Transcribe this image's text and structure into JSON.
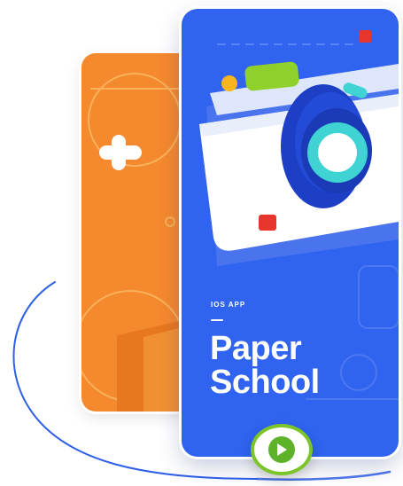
{
  "app": {
    "eyebrow": "IOS APP",
    "title_line1": "Paper",
    "title_line2": "School"
  },
  "colors": {
    "primary_blue": "#2f63f0",
    "orange": "#f5892e",
    "accent_green": "#7bc52a",
    "accent_red": "#e8352c",
    "accent_yellow": "#f7b51e"
  },
  "icons": {
    "camera": "camera-illustration-icon",
    "play": "play-icon",
    "plus": "plus-icon"
  }
}
